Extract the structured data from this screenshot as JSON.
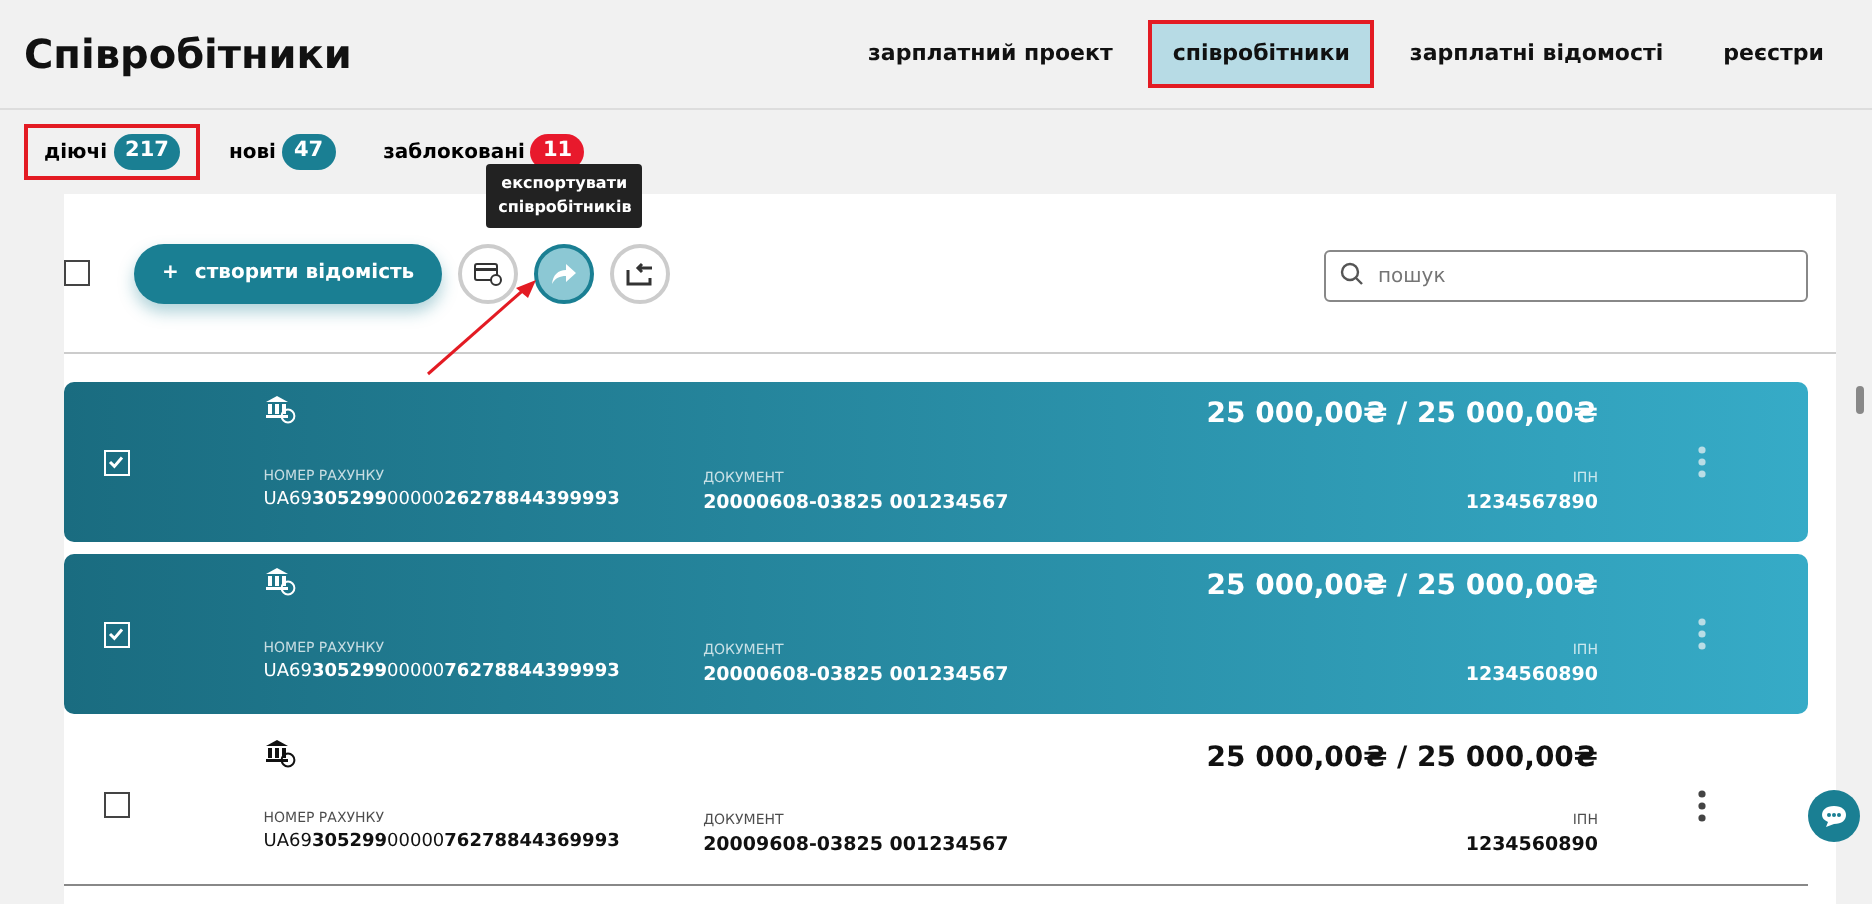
{
  "title": "Співробітники",
  "nav": [
    {
      "label": "зарплатний проект",
      "selected": false,
      "highlighted": false
    },
    {
      "label": "співробітники",
      "selected": true,
      "highlighted": true
    },
    {
      "label": "зарплатні відомості",
      "selected": false,
      "highlighted": false
    },
    {
      "label": "реєстри",
      "selected": false,
      "highlighted": false
    }
  ],
  "filters": [
    {
      "label": "діючі",
      "count": "217",
      "highlighted": true,
      "color": "#1a7f93"
    },
    {
      "label": "нові",
      "count": "47",
      "highlighted": false,
      "color": "#1a7f93"
    },
    {
      "label": "заблоковані",
      "count": "11",
      "highlighted": false,
      "color": "#e8192c"
    }
  ],
  "toolbar": {
    "select_all": {
      "checked": false
    },
    "create_button": {
      "icon": "+",
      "label": "створити відомість"
    },
    "tooltip": "експортувати співробітників",
    "search": {
      "placeholder": "пошук"
    }
  },
  "employees": [
    {
      "selected": true,
      "amount": "25 000,00₴ / 25 000,00₴",
      "account_label": "НОМЕР РАХУНКУ",
      "account": "UA69**305299**00000**26278844399993**",
      "document_label": "ДОКУМЕНТ",
      "document": "20000608-03825 001234567",
      "tax_label": "ІПН",
      "tax_id": "1234567890"
    },
    {
      "selected": true,
      "amount": "25 000,00₴ / 25 000,00₴",
      "account_label": "НОМЕР РАХУНКУ",
      "account": "UA69**305299**00000**76278844399993**",
      "document_label": "ДОКУМЕНТ",
      "document": "20000608-03825 001234567",
      "tax_label": "ІПН",
      "tax_id": "1234560890"
    },
    {
      "selected": false,
      "amount": "25 000,00₴ / 25 000,00₴",
      "account_label": "НОМЕР РАХУНКУ",
      "account": "UA69**305299**00000**76278844369993**",
      "document_label": "ДОКУМЕНТ",
      "document": "20009608-03825 001234567",
      "tax_label": "ІПН",
      "tax_id": "1234560890"
    }
  ]
}
